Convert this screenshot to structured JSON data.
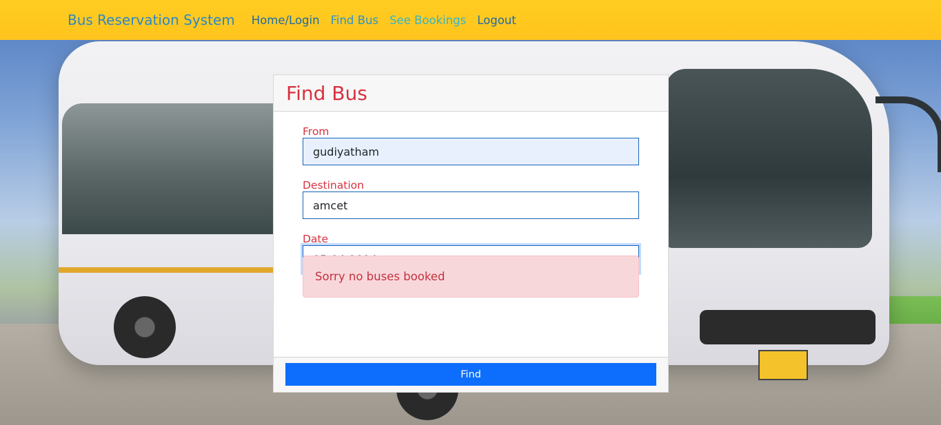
{
  "navbar": {
    "brand": "Bus Reservation System",
    "links": {
      "home": "Home/Login",
      "find_bus": "Find Bus",
      "see_bookings": "See Bookings",
      "logout": "Logout"
    }
  },
  "form": {
    "title": "Find Bus",
    "from_label": "From",
    "from_value": "gudiyatham",
    "destination_label": "Destination",
    "destination_value": "amcet",
    "date_label": "Date",
    "date_value": "05-04-2024",
    "alert_message": "Sorry no buses booked",
    "submit_label": "Find"
  },
  "colors": {
    "navbar_bg": "#ffc41d",
    "accent_red": "#d7313f",
    "primary_button": "#0d6efd",
    "alert_bg": "#f8d7da"
  }
}
